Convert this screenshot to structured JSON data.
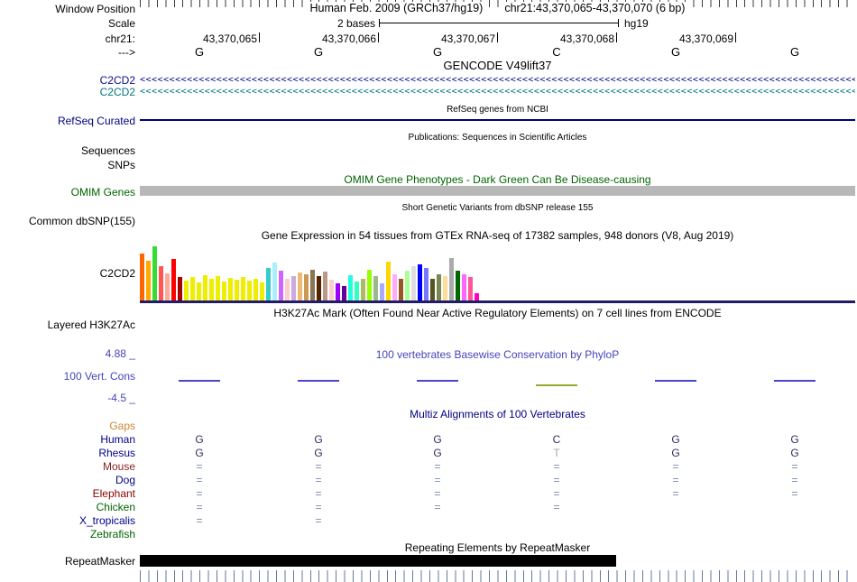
{
  "header": {
    "window_position_label": "Window Position",
    "assembly": "Human Feb. 2009 (GRCh37/hg19)",
    "position": "chr21:43,370,065-43,370,070 (6 bp)",
    "scale_label": "Scale",
    "scale_value": "2 bases",
    "genome": "hg19",
    "chrom_label": "chr21:",
    "strand_label": "--->",
    "coordinates": [
      "43,370,065",
      "43,370,066",
      "43,370,067",
      "43,370,068",
      "43,370,069"
    ],
    "bases": [
      "G",
      "G",
      "G",
      "C",
      "G",
      "G"
    ]
  },
  "tracks": {
    "gencode": {
      "title": "GENCODE V49lift37",
      "genes": [
        {
          "label": "C2CD2",
          "color": "#0c0c8c",
          "strand_char": "<"
        },
        {
          "label": "C2CD2",
          "color": "#007878",
          "strand_char": "<"
        }
      ]
    },
    "refseq": {
      "label": "RefSeq Curated",
      "center_label": "RefSeq genes from NCBI",
      "color": "#000080"
    },
    "publications": {
      "center_label": "Publications: Sequences in Scientific Articles"
    },
    "sequences_label": "Sequences",
    "snps_label": "SNPs",
    "omim": {
      "title": "OMIM Gene Phenotypes - Dark Green Can Be Disease-causing",
      "label": "OMIM Genes",
      "color": "#006400",
      "bar_color": "#b8b8b8"
    },
    "dbsnp": {
      "center_label": "Short Genetic Variants from dbSNP release 155",
      "label": "Common dbSNP(155)"
    },
    "gtex": {
      "title": "Gene Expression in 54 tissues from GTEx RNA-seq of 17382 samples, 948 donors (V8, Aug 2019)",
      "label": "C2CD2",
      "baseline_color": "#221b66"
    },
    "h3k27ac": {
      "title": "H3K27Ac Mark (Often Found Near Active Regulatory Elements) on 7 cell lines from ENCODE",
      "label": "Layered H3K27Ac"
    },
    "phylop": {
      "title": "100 vertebrates Basewise Conservation by PhyloP",
      "label": "100 Vert. Cons",
      "max_label": "4.88 _",
      "min_label": "-4.5 _",
      "pos_color": "#4848c8",
      "neg_color": "#9aa832"
    },
    "multiz": {
      "title": "Multiz Alignments of 100 Vertebrates",
      "rows": [
        {
          "label": "Gaps",
          "color": "#cc8833",
          "text_color": "#7a88a8",
          "cells": [
            "",
            "",
            "",
            "",
            "",
            ""
          ]
        },
        {
          "label": "Human",
          "color": "#00008b",
          "text_color": "#2f2f5f",
          "cells": [
            "G",
            "G",
            "G",
            "C",
            "G",
            "G"
          ]
        },
        {
          "label": "Rhesus",
          "color": "#00008b",
          "text_color": "#2f2f5f",
          "cells": [
            "G",
            "G",
            "G",
            "T",
            "G",
            "G"
          ],
          "cell_colors": [
            null,
            null,
            null,
            "#a8a8a8",
            null,
            null
          ]
        },
        {
          "label": "Mouse",
          "color": "#8b2323",
          "text_color": "#7a88a8",
          "cells": [
            "=",
            "=",
            "=",
            "=",
            "=",
            "="
          ]
        },
        {
          "label": "Dog",
          "color": "#00008b",
          "text_color": "#7a88a8",
          "cells": [
            "=",
            "=",
            "=",
            "=",
            "=",
            "="
          ]
        },
        {
          "label": "Elephant",
          "color": "#8b0000",
          "text_color": "#7a88a8",
          "cells": [
            "=",
            "=",
            "=",
            "=",
            "=",
            "="
          ]
        },
        {
          "label": "Chicken",
          "color": "#006400",
          "text_color": "#7a88a8",
          "cells": [
            "=",
            "=",
            "=",
            "=",
            "",
            ""
          ]
        },
        {
          "label": "X_tropicalis",
          "color": "#00008b",
          "text_color": "#7a88a8",
          "cells": [
            "=",
            "=",
            "",
            "",
            "",
            ""
          ]
        },
        {
          "label": "Zebrafish",
          "color": "#006400",
          "text_color": "#7a88a8",
          "cells": [
            "",
            "",
            "",
            "",
            "",
            ""
          ]
        }
      ]
    },
    "repeatmasker": {
      "title": "Repeating Elements by RepeatMasker",
      "label": "RepeatMasker",
      "bar_color": "#000000"
    }
  },
  "chart_data": [
    {
      "type": "bar",
      "title": "Gene Expression in 54 tissues from GTEx RNA-seq of 17382 samples, 948 donors (V8, Aug 2019)",
      "gene": "C2CD2",
      "units": "relative expression bar height (px); tissue names not shown in image, colors follow GTEx tissue palette",
      "bar_colors": [
        "#FF6600",
        "#FFAA00",
        "#33DD33",
        "#FF5555",
        "#FFAA99",
        "#FF0000",
        "#AA0000",
        "#EEEE00",
        "#EEEE00",
        "#EEEE00",
        "#EEEE00",
        "#EEEE00",
        "#EEEE00",
        "#EEEE00",
        "#EEEE00",
        "#EEEE00",
        "#EEEE00",
        "#EEEE00",
        "#EEEE00",
        "#EEEE00",
        "#33CCCC",
        "#AAEEFF",
        "#CC66FF",
        "#FFCCCC",
        "#CCAADD",
        "#EEBB77",
        "#CC9955",
        "#8B7355",
        "#552200",
        "#BB9988",
        "#FFCCCC",
        "#9900FF",
        "#660099",
        "#22FFDD",
        "#33FFC2",
        "#AABB66",
        "#99FF00",
        "#99BB88",
        "#AAAAFF",
        "#FFD700",
        "#FFAAFF",
        "#995522",
        "#AAFF99",
        "#DDDDDD",
        "#0000FF",
        "#7777FF",
        "#555522",
        "#778855",
        "#FFDD99",
        "#AAAAAA",
        "#006600",
        "#FF66FF",
        "#FF5599",
        "#FF00BB"
      ],
      "values": [
        52,
        44,
        60,
        38,
        30,
        46,
        26,
        22,
        26,
        20,
        28,
        24,
        27,
        21,
        25,
        23,
        26,
        22,
        24,
        20,
        36,
        42,
        33,
        24,
        27,
        31,
        29,
        34,
        27,
        32,
        23,
        19,
        16,
        28,
        21,
        24,
        34,
        27,
        19,
        43,
        29,
        24,
        33,
        38,
        40,
        36,
        24,
        29,
        27,
        47,
        33,
        29,
        26,
        8
      ]
    },
    {
      "type": "line",
      "title": "100 vertebrates Basewise Conservation by PhyloP",
      "ylim": [
        -4.5,
        4.88
      ],
      "x_bases": [
        "G",
        "G",
        "G",
        "C",
        "G",
        "G"
      ],
      "values": [
        0.15,
        0.15,
        0.15,
        -0.4,
        0.15,
        0.15
      ]
    }
  ]
}
